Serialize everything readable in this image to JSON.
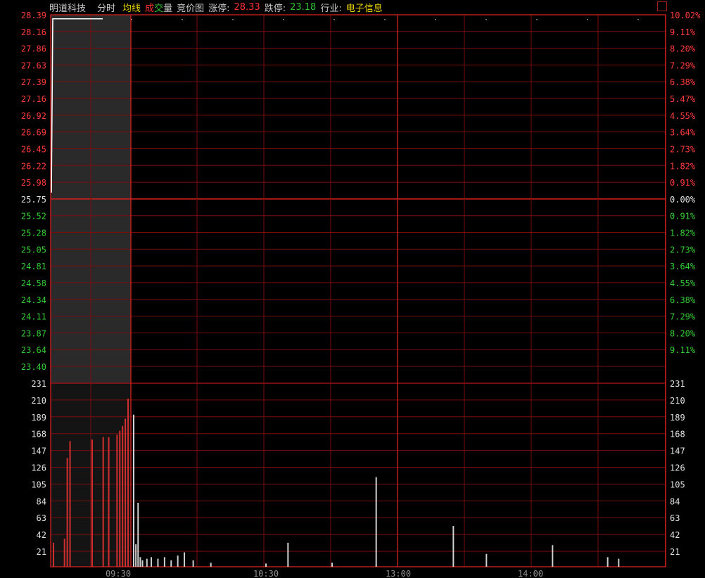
{
  "header": {
    "stock_name": "明道科技",
    "tab_time": "分时",
    "tab_avg": "均线",
    "vol_prefix": "成",
    "vol_mid": "交",
    "vol_suffix": "量",
    "auction_label": "竞价图",
    "limit_up_label": "涨停:",
    "limit_up_value": "28.33",
    "limit_down_label": "跌停:",
    "limit_down_value": "23.18",
    "industry_label": "行业:",
    "industry_value": "电子信息"
  },
  "colors": {
    "grid": "#7a0e0e",
    "grid_strong": "#c81e1e",
    "up": "#ff3b3b",
    "down": "#33cc33",
    "neutral": "#e0e0e0",
    "price_line": "#ffffff",
    "volume_up": "#d23030",
    "volume_down": "#d0d0d0"
  },
  "chart_data": {
    "type": "line",
    "price_axis": {
      "ticks": [
        "28.39",
        "28.16",
        "27.86",
        "27.63",
        "27.39",
        "27.16",
        "26.92",
        "26.69",
        "26.45",
        "26.22",
        "25.98",
        "25.75",
        "25.52",
        "25.28",
        "25.05",
        "24.81",
        "24.58",
        "24.34",
        "24.11",
        "23.87",
        "23.64",
        "23.40"
      ],
      "reference": "25.75",
      "ylim": [
        23.17,
        28.39
      ]
    },
    "percent_axis": {
      "ticks": [
        "10.02%",
        "9.11%",
        "8.20%",
        "7.29%",
        "6.38%",
        "5.47%",
        "4.55%",
        "3.64%",
        "2.73%",
        "1.82%",
        "0.91%",
        "0.00%",
        "0.91%",
        "1.82%",
        "2.73%",
        "3.64%",
        "4.55%",
        "6.38%",
        "7.29%",
        "8.20%",
        "9.11%"
      ]
    },
    "volume_axis": {
      "ticks": [
        "231",
        "210",
        "189",
        "168",
        "147",
        "126",
        "105",
        "84",
        "63",
        "42",
        "21"
      ],
      "ylim": [
        0,
        231
      ]
    },
    "time_axis": {
      "ticks": [
        "09:30",
        "10:30",
        "13:00",
        "14:00"
      ]
    },
    "auction_volume": [
      30,
      0,
      0,
      0,
      35,
      136,
      157,
      0,
      0,
      0,
      0,
      0,
      0,
      0,
      159,
      0,
      0,
      0,
      162,
      0,
      162,
      0,
      0,
      165,
      170,
      176,
      185,
      210
    ],
    "session_volume": [
      {
        "time": "09:30",
        "volume": 190,
        "dir": "down"
      },
      {
        "time": "09:31",
        "volume": 28,
        "dir": "down"
      },
      {
        "time": "09:32",
        "volume": 80,
        "dir": "down"
      },
      {
        "time": "09:33",
        "volume": 12,
        "dir": "down"
      },
      {
        "time": "09:34",
        "volume": 8,
        "dir": "down"
      },
      {
        "time": "09:36",
        "volume": 10,
        "dir": "down"
      },
      {
        "time": "09:38",
        "volume": 12,
        "dir": "down"
      },
      {
        "time": "09:41",
        "volume": 10,
        "dir": "down"
      },
      {
        "time": "09:44",
        "volume": 12,
        "dir": "down"
      },
      {
        "time": "09:47",
        "volume": 8,
        "dir": "down"
      },
      {
        "time": "09:50",
        "volume": 14,
        "dir": "down"
      },
      {
        "time": "09:53",
        "volume": 18,
        "dir": "down"
      },
      {
        "time": "09:57",
        "volume": 8,
        "dir": "down"
      },
      {
        "time": "10:05",
        "volume": 5,
        "dir": "down"
      },
      {
        "time": "10:30",
        "volume": 4,
        "dir": "down"
      },
      {
        "time": "10:40",
        "volume": 30,
        "dir": "down"
      },
      {
        "time": "11:00",
        "volume": 5,
        "dir": "down"
      },
      {
        "time": "11:20",
        "volume": 112,
        "dir": "down"
      },
      {
        "time": "13:25",
        "volume": 51,
        "dir": "down"
      },
      {
        "time": "13:40",
        "volume": 16,
        "dir": "down"
      },
      {
        "time": "14:10",
        "volume": 27,
        "dir": "down"
      },
      {
        "time": "14:35",
        "volume": 12,
        "dir": "down"
      },
      {
        "time": "14:40",
        "volume": 10,
        "dir": "down"
      }
    ],
    "price_series": {
      "name": "",
      "note": "price pinned at 28.33 limit-up for the entire session",
      "value": 28.33
    }
  }
}
